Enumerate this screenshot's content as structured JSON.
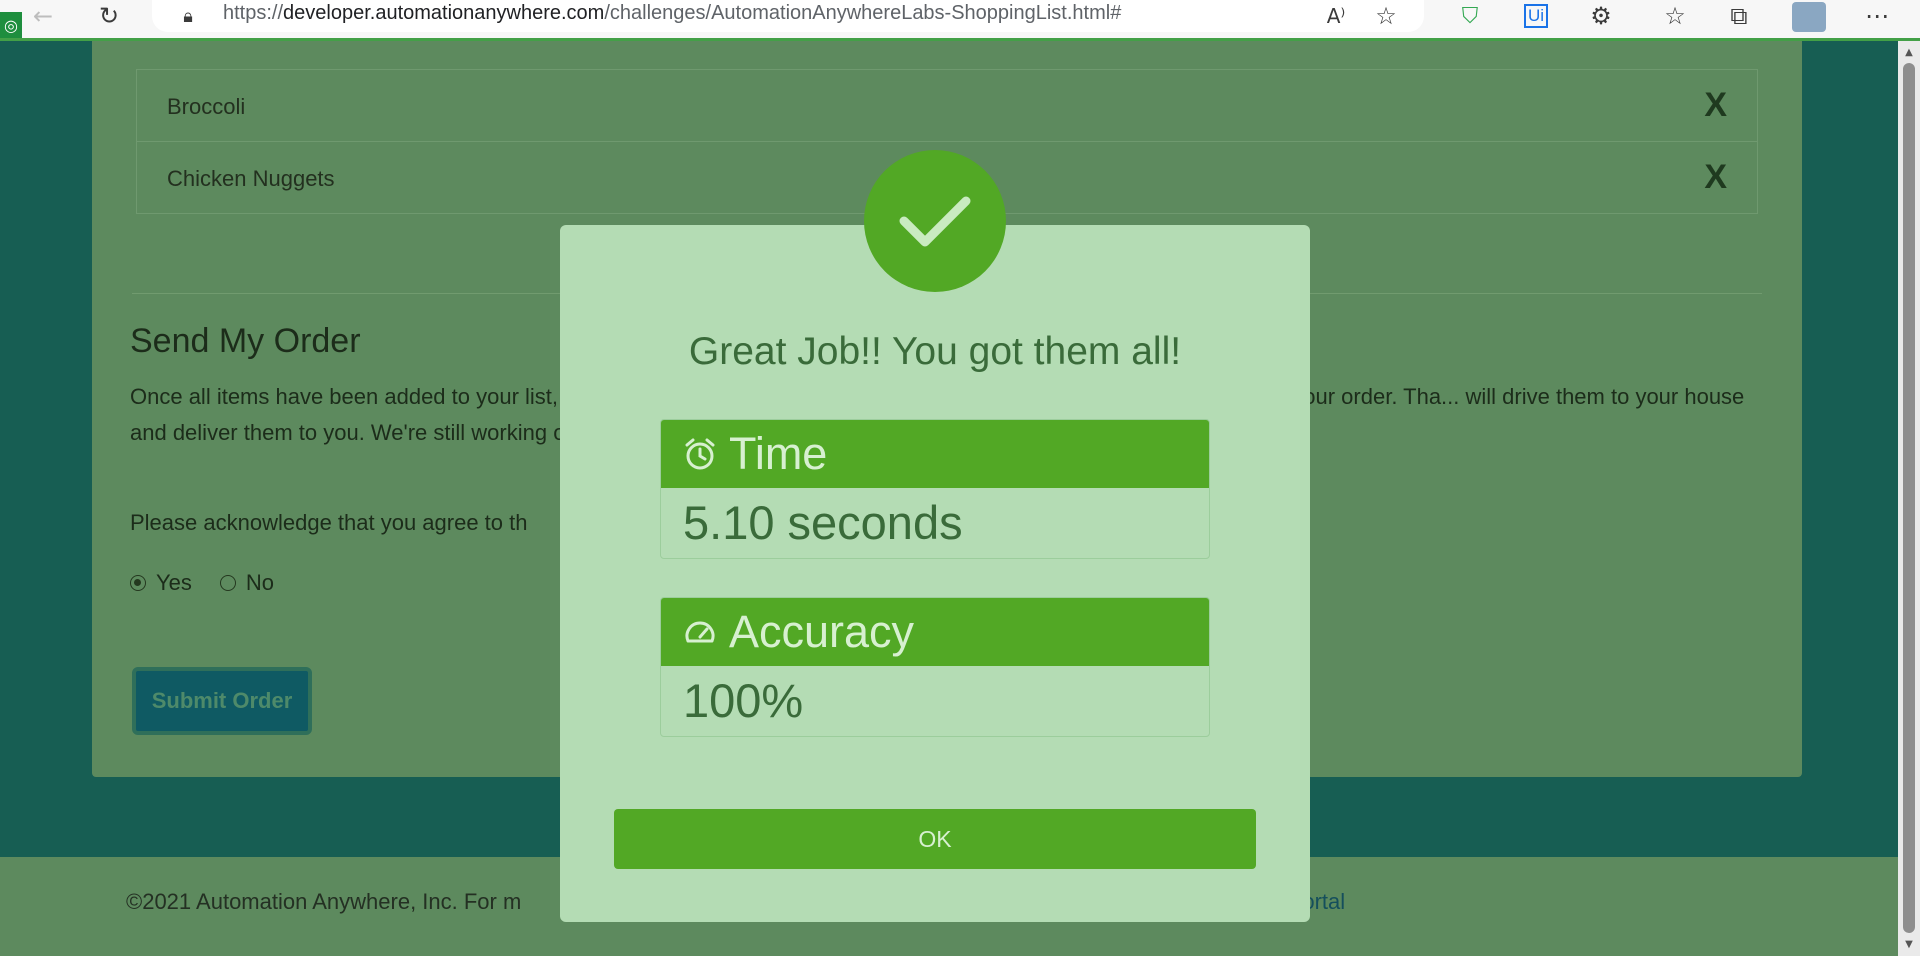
{
  "browser": {
    "url_prefix": "https://",
    "url_host": "developer.automationanywhere.com",
    "url_path": "/challenges/AutomationAnywhereLabs-ShoppingList.html#",
    "extension_label": "Ui"
  },
  "shopping_list": {
    "items": [
      {
        "label": "Broccoli",
        "remove": "X"
      },
      {
        "label": "Chicken Nuggets",
        "remove": "X"
      }
    ]
  },
  "order": {
    "title": "Send My Order",
    "text": "Once all items have been added to your list, our shoppers will go find all items you've entered in your list and assemble your order. Tha... will drive them to your house and deliver them to you. We're still working on a robo...",
    "ack": "Please acknowledge that you agree to th",
    "radio_yes": "Yes",
    "radio_no": "No",
    "radio_selected": "Yes",
    "submit_label": "Submit Order"
  },
  "footer": {
    "text": "©2021 Automation Anywhere, Inc. For m",
    "link": "er Portal"
  },
  "modal": {
    "title": "Great Job!! You got them all!",
    "time_label": "Time",
    "time_value": "5.10 seconds",
    "accuracy_label": "Accuracy",
    "accuracy_value": "100%",
    "ok_label": "OK"
  },
  "colors": {
    "page_bg": "#175e53",
    "card_bg": "#5d8a5e",
    "modal_bg": "#b4dcb4",
    "accent_green": "#52a825"
  }
}
